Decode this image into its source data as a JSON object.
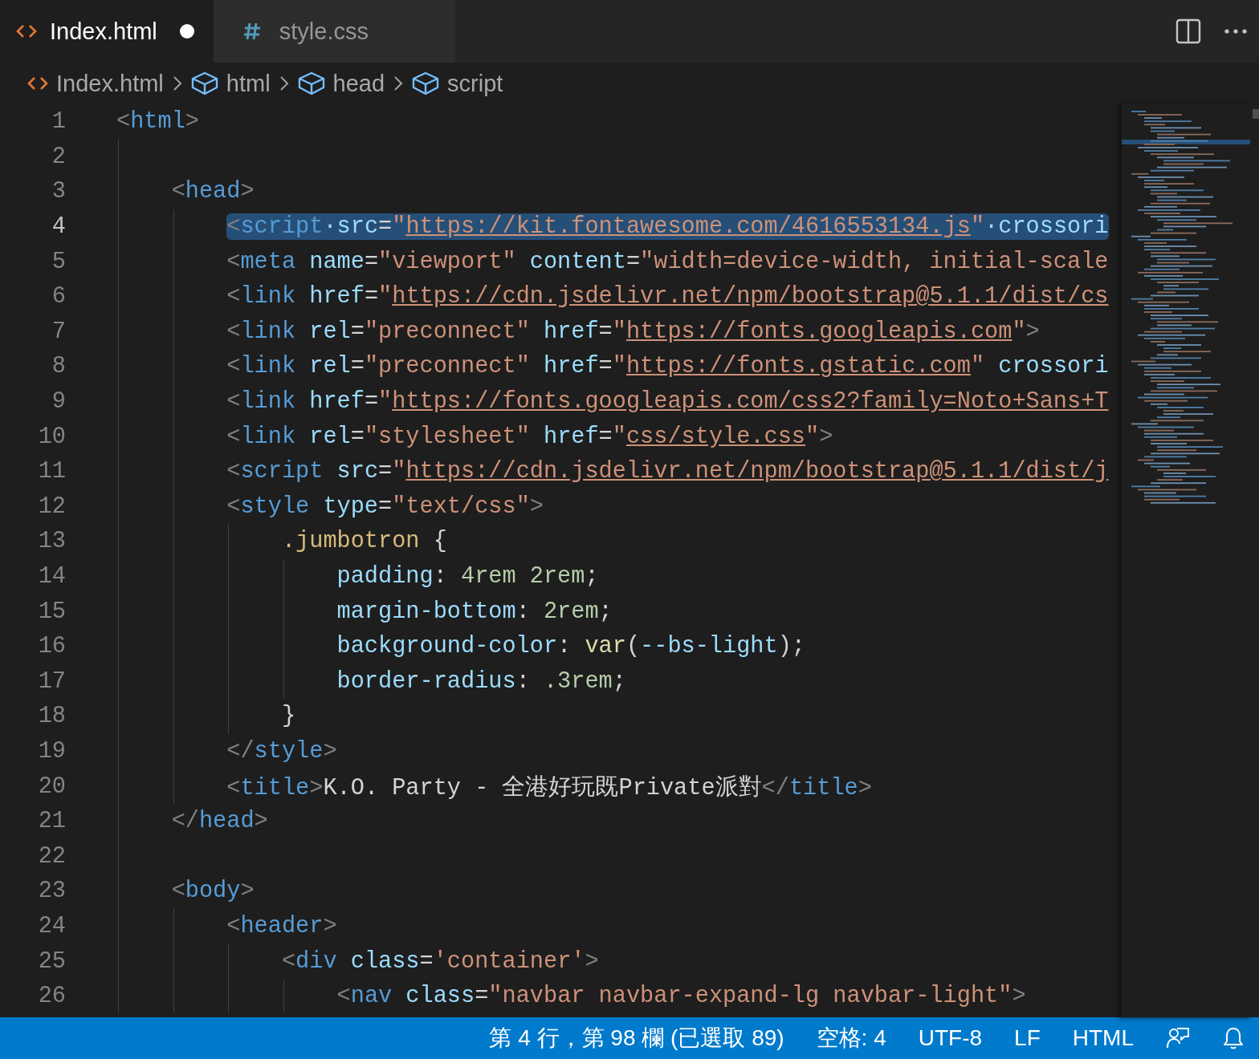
{
  "tabs": [
    {
      "label": "Index.html",
      "selected": true,
      "modified": true,
      "kind": "html"
    },
    {
      "label": "style.css",
      "selected": false,
      "modified": false,
      "kind": "css"
    }
  ],
  "breadcrumb": [
    {
      "label": "Index.html",
      "kind": "file"
    },
    {
      "label": "html",
      "kind": "element"
    },
    {
      "label": "head",
      "kind": "element"
    },
    {
      "label": "script",
      "kind": "element"
    }
  ],
  "editor": {
    "lines": [
      {
        "number": "1",
        "current": false,
        "selected": false,
        "tokens": [
          {
            "kind": "bracket",
            "text": "<"
          },
          {
            "kind": "tag",
            "text": "html"
          },
          {
            "kind": "bracket",
            "text": ">"
          }
        ],
        "children": [
          {
            "number": "2",
            "current": false,
            "selected": false
          },
          {
            "number": "3",
            "current": false,
            "selected": false,
            "tokens": [
              {
                "kind": "bracket",
                "text": "<"
              },
              {
                "kind": "tag",
                "text": "head"
              },
              {
                "kind": "bracket",
                "text": ">"
              }
            ],
            "children": [
              {
                "number": "4",
                "current": true,
                "selected": true,
                "tokens": [
                  {
                    "kind": "bracket",
                    "text": "<"
                  },
                  {
                    "kind": "tag",
                    "text": "script"
                  },
                  {
                    "kind": "attr",
                    "text": "·src"
                  },
                  {
                    "kind": "plain",
                    "text": "="
                  },
                  {
                    "kind": "string",
                    "text": "\""
                  },
                  {
                    "kind": "link",
                    "text": "https://kit.fontawesome.com/4616553134.js"
                  },
                  {
                    "kind": "string",
                    "text": "\""
                  },
                  {
                    "kind": "attr",
                    "text": "·crossori"
                  }
                ]
              },
              {
                "number": "5",
                "current": false,
                "selected": false,
                "tokens": [
                  {
                    "kind": "bracket",
                    "text": "<"
                  },
                  {
                    "kind": "tag",
                    "text": "meta"
                  },
                  {
                    "kind": "attr",
                    "text": " name"
                  },
                  {
                    "kind": "plain",
                    "text": "="
                  },
                  {
                    "kind": "string",
                    "text": "\"viewport\""
                  },
                  {
                    "kind": "attr",
                    "text": " content"
                  },
                  {
                    "kind": "plain",
                    "text": "="
                  },
                  {
                    "kind": "string",
                    "text": "\"width=device-width, initial-scale"
                  }
                ]
              },
              {
                "number": "6",
                "current": false,
                "selected": false,
                "tokens": [
                  {
                    "kind": "bracket",
                    "text": "<"
                  },
                  {
                    "kind": "tag",
                    "text": "link"
                  },
                  {
                    "kind": "attr",
                    "text": " href"
                  },
                  {
                    "kind": "plain",
                    "text": "="
                  },
                  {
                    "kind": "string",
                    "text": "\""
                  },
                  {
                    "kind": "link",
                    "text": "https://cdn.jsdelivr.net/npm/bootstrap@5.1.1/dist/cs"
                  }
                ]
              },
              {
                "number": "7",
                "current": false,
                "selected": false,
                "tokens": [
                  {
                    "kind": "bracket",
                    "text": "<"
                  },
                  {
                    "kind": "tag",
                    "text": "link"
                  },
                  {
                    "kind": "attr",
                    "text": " rel"
                  },
                  {
                    "kind": "plain",
                    "text": "="
                  },
                  {
                    "kind": "string",
                    "text": "\"preconnect\""
                  },
                  {
                    "kind": "attr",
                    "text": " href"
                  },
                  {
                    "kind": "plain",
                    "text": "="
                  },
                  {
                    "kind": "string",
                    "text": "\""
                  },
                  {
                    "kind": "link",
                    "text": "https://fonts.googleapis.com"
                  },
                  {
                    "kind": "string",
                    "text": "\""
                  },
                  {
                    "kind": "bracket",
                    "text": ">"
                  }
                ]
              },
              {
                "number": "8",
                "current": false,
                "selected": false,
                "tokens": [
                  {
                    "kind": "bracket",
                    "text": "<"
                  },
                  {
                    "kind": "tag",
                    "text": "link"
                  },
                  {
                    "kind": "attr",
                    "text": " rel"
                  },
                  {
                    "kind": "plain",
                    "text": "="
                  },
                  {
                    "kind": "string",
                    "text": "\"preconnect\""
                  },
                  {
                    "kind": "attr",
                    "text": " href"
                  },
                  {
                    "kind": "plain",
                    "text": "="
                  },
                  {
                    "kind": "string",
                    "text": "\""
                  },
                  {
                    "kind": "link",
                    "text": "https://fonts.gstatic.com"
                  },
                  {
                    "kind": "string",
                    "text": "\""
                  },
                  {
                    "kind": "attr",
                    "text": " crossori"
                  }
                ]
              },
              {
                "number": "9",
                "current": false,
                "selected": false,
                "tokens": [
                  {
                    "kind": "bracket",
                    "text": "<"
                  },
                  {
                    "kind": "tag",
                    "text": "link"
                  },
                  {
                    "kind": "attr",
                    "text": " href"
                  },
                  {
                    "kind": "plain",
                    "text": "="
                  },
                  {
                    "kind": "string",
                    "text": "\""
                  },
                  {
                    "kind": "link",
                    "text": "https://fonts.googleapis.com/css2?family=Noto+Sans+T"
                  }
                ]
              },
              {
                "number": "10",
                "current": false,
                "selected": false,
                "tokens": [
                  {
                    "kind": "bracket",
                    "text": "<"
                  },
                  {
                    "kind": "tag",
                    "text": "link"
                  },
                  {
                    "kind": "attr",
                    "text": " rel"
                  },
                  {
                    "kind": "plain",
                    "text": "="
                  },
                  {
                    "kind": "string",
                    "text": "\"stylesheet\""
                  },
                  {
                    "kind": "attr",
                    "text": " href"
                  },
                  {
                    "kind": "plain",
                    "text": "="
                  },
                  {
                    "kind": "string",
                    "text": "\""
                  },
                  {
                    "kind": "link",
                    "text": "css/style.css"
                  },
                  {
                    "kind": "string",
                    "text": "\""
                  },
                  {
                    "kind": "bracket",
                    "text": ">"
                  }
                ]
              },
              {
                "number": "11",
                "current": false,
                "selected": false,
                "tokens": [
                  {
                    "kind": "bracket",
                    "text": "<"
                  },
                  {
                    "kind": "tag",
                    "text": "script"
                  },
                  {
                    "kind": "attr",
                    "text": " src"
                  },
                  {
                    "kind": "plain",
                    "text": "="
                  },
                  {
                    "kind": "string",
                    "text": "\""
                  },
                  {
                    "kind": "link",
                    "text": "https://cdn.jsdelivr.net/npm/bootstrap@5.1.1/dist/j"
                  }
                ]
              },
              {
                "number": "12",
                "current": false,
                "selected": false,
                "tokens": [
                  {
                    "kind": "bracket",
                    "text": "<"
                  },
                  {
                    "kind": "tag",
                    "text": "style"
                  },
                  {
                    "kind": "attr",
                    "text": " type"
                  },
                  {
                    "kind": "plain",
                    "text": "="
                  },
                  {
                    "kind": "string",
                    "text": "\"text/css\""
                  },
                  {
                    "kind": "bracket",
                    "text": ">"
                  }
                ],
                "children": [
                  {
                    "number": "13",
                    "current": false,
                    "selected": false,
                    "tokens": [
                      {
                        "kind": "selector",
                        "text": ".jumbotron"
                      },
                      {
                        "kind": "plain",
                        "text": " {"
                      }
                    ],
                    "children": [
                      {
                        "number": "14",
                        "current": false,
                        "selected": false,
                        "tokens": [
                          {
                            "kind": "property",
                            "text": "padding"
                          },
                          {
                            "kind": "plain",
                            "text": ": "
                          },
                          {
                            "kind": "number",
                            "text": "4rem 2rem"
                          },
                          {
                            "kind": "plain",
                            "text": ";"
                          }
                        ]
                      },
                      {
                        "number": "15",
                        "current": false,
                        "selected": false,
                        "tokens": [
                          {
                            "kind": "property",
                            "text": "margin-bottom"
                          },
                          {
                            "kind": "plain",
                            "text": ": "
                          },
                          {
                            "kind": "number",
                            "text": "2rem"
                          },
                          {
                            "kind": "plain",
                            "text": ";"
                          }
                        ]
                      },
                      {
                        "number": "16",
                        "current": false,
                        "selected": false,
                        "tokens": [
                          {
                            "kind": "property",
                            "text": "background-color"
                          },
                          {
                            "kind": "plain",
                            "text": ": "
                          },
                          {
                            "kind": "function",
                            "text": "var"
                          },
                          {
                            "kind": "plain",
                            "text": "("
                          },
                          {
                            "kind": "property",
                            "text": "--bs-light"
                          },
                          {
                            "kind": "plain",
                            "text": ");"
                          }
                        ]
                      },
                      {
                        "number": "17",
                        "current": false,
                        "selected": false,
                        "tokens": [
                          {
                            "kind": "property",
                            "text": "border-radius"
                          },
                          {
                            "kind": "plain",
                            "text": ": "
                          },
                          {
                            "kind": "number",
                            "text": ".3rem"
                          },
                          {
                            "kind": "plain",
                            "text": ";"
                          }
                        ]
                      }
                    ]
                  },
                  {
                    "number": "18",
                    "current": false,
                    "selected": false,
                    "tokens": [
                      {
                        "kind": "plain",
                        "text": "}"
                      }
                    ]
                  }
                ]
              },
              {
                "number": "19",
                "current": false,
                "selected": false,
                "tokens": [
                  {
                    "kind": "bracket",
                    "text": "</"
                  },
                  {
                    "kind": "tag",
                    "text": "style"
                  },
                  {
                    "kind": "bracket",
                    "text": ">"
                  }
                ]
              },
              {
                "number": "20",
                "current": false,
                "selected": false,
                "tokens": [
                  {
                    "kind": "bracket",
                    "text": "<"
                  },
                  {
                    "kind": "tag",
                    "text": "title"
                  },
                  {
                    "kind": "bracket",
                    "text": ">"
                  },
                  {
                    "kind": "plain",
                    "text": "K.O. Party - 全港好玩既Private派對"
                  },
                  {
                    "kind": "bracket",
                    "text": "</"
                  },
                  {
                    "kind": "tag",
                    "text": "title"
                  },
                  {
                    "kind": "bracket",
                    "text": ">"
                  }
                ]
              }
            ]
          },
          {
            "number": "21",
            "current": false,
            "selected": false,
            "tokens": [
              {
                "kind": "bracket",
                "text": "</"
              },
              {
                "kind": "tag",
                "text": "head"
              },
              {
                "kind": "bracket",
                "text": ">"
              }
            ]
          },
          {
            "number": "22",
            "current": false,
            "selected": false
          },
          {
            "number": "23",
            "current": false,
            "selected": false,
            "tokens": [
              {
                "kind": "bracket",
                "text": "<"
              },
              {
                "kind": "tag",
                "text": "body"
              },
              {
                "kind": "bracket",
                "text": ">"
              }
            ],
            "children": [
              {
                "number": "24",
                "current": false,
                "selected": false,
                "tokens": [
                  {
                    "kind": "bracket",
                    "text": "<"
                  },
                  {
                    "kind": "tag",
                    "text": "header"
                  },
                  {
                    "kind": "bracket",
                    "text": ">"
                  }
                ],
                "children": [
                  {
                    "number": "25",
                    "current": false,
                    "selected": false,
                    "tokens": [
                      {
                        "kind": "bracket",
                        "text": "<"
                      },
                      {
                        "kind": "tag",
                        "text": "div"
                      },
                      {
                        "kind": "attr",
                        "text": " class"
                      },
                      {
                        "kind": "plain",
                        "text": "="
                      },
                      {
                        "kind": "string",
                        "text": "'container'"
                      },
                      {
                        "kind": "bracket",
                        "text": ">"
                      }
                    ],
                    "children": [
                      {
                        "number": "26",
                        "current": false,
                        "selected": false,
                        "tokens": [
                          {
                            "kind": "bracket",
                            "text": "<"
                          },
                          {
                            "kind": "tag",
                            "text": "nav"
                          },
                          {
                            "kind": "attr",
                            "text": " class"
                          },
                          {
                            "kind": "plain",
                            "text": "="
                          },
                          {
                            "kind": "string",
                            "text": "\"navbar navbar-expand-lg navbar-light\""
                          },
                          {
                            "kind": "bracket",
                            "text": ">"
                          }
                        ]
                      }
                    ]
                  }
                ]
              }
            ]
          }
        ]
      }
    ]
  },
  "status_bar": {
    "items": [
      "第 4 行，第 98 欄 (已選取 89)",
      "空格: 4",
      "UTF-8",
      "LF",
      "HTML"
    ]
  }
}
